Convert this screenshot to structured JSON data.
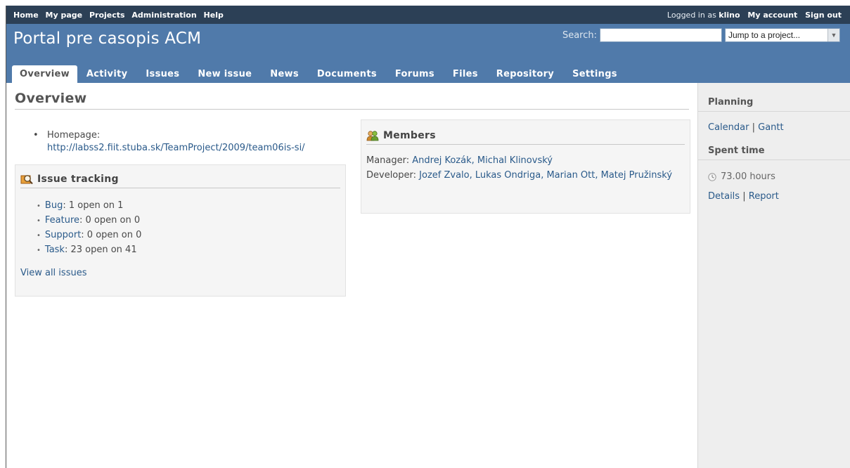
{
  "top_menu": {
    "items": [
      "Home",
      "My page",
      "Projects",
      "Administration",
      "Help"
    ],
    "logged_prefix": "Logged in as",
    "user": "klino",
    "my_account": "My account",
    "sign_out": "Sign out"
  },
  "header": {
    "title": "Portal pre casopis ACM",
    "search_label": "Search:",
    "search_value": "",
    "jump_label": "Jump to a project..."
  },
  "tabs": [
    "Overview",
    "Activity",
    "Issues",
    "New issue",
    "News",
    "Documents",
    "Forums",
    "Files",
    "Repository",
    "Settings"
  ],
  "main": {
    "page_title": "Overview",
    "homepage_label": "Homepage:",
    "homepage_url": "http://labss2.fiit.stuba.sk/TeamProject/2009/team06is-si/",
    "issue_tracking": {
      "title": "Issue tracking",
      "items": [
        {
          "tracker": "Bug",
          "text": ": 1 open on 1"
        },
        {
          "tracker": "Feature",
          "text": ": 0 open on 0"
        },
        {
          "tracker": "Support",
          "text": ": 0 open on 0"
        },
        {
          "tracker": "Task",
          "text": ": 23 open on 41"
        }
      ],
      "view_all": "View all issues"
    },
    "members": {
      "title": "Members",
      "manager_label": "Manager:",
      "managers": "Andrej Kozák, Michal Klinovský",
      "developer_label": "Developer:",
      "developers": "Jozef Zvalo, Lukas Ondriga, Marian Ott, Matej Pružinský"
    }
  },
  "sidebar": {
    "planning_title": "Planning",
    "calendar": "Calendar",
    "gantt": "Gantt",
    "spent_title": "Spent time",
    "hours": "73.00 hours",
    "details": "Details",
    "report": "Report",
    "separator": "|"
  },
  "colors": {
    "top_menu_bg": "#2c4056",
    "header_bg": "#507aaa",
    "link": "#2a5a8a",
    "sidebar_bg": "#eeeeee"
  }
}
